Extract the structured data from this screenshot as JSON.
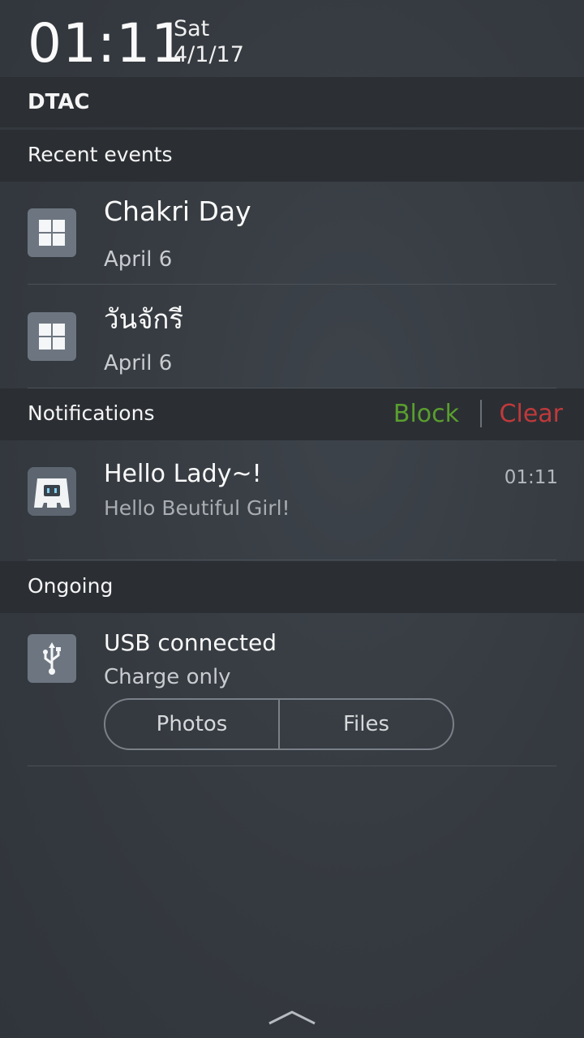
{
  "status": {
    "time": "01:11",
    "day": "Sat",
    "date": "4/1/17"
  },
  "carrier": "DTAC",
  "recent_events": {
    "header": "Recent events",
    "items": [
      {
        "title": "Chakri Day",
        "date": "April 6",
        "icon": "calendar-grid-icon"
      },
      {
        "title": "วันจักรี",
        "date": "April 6",
        "icon": "calendar-grid-icon"
      }
    ]
  },
  "notifications": {
    "header": "Notifications",
    "block_label": "Block",
    "clear_label": "Clear",
    "block_color": "#5a9e2e",
    "clear_color": "#c0393b",
    "items": [
      {
        "title": "Hello Lady~!",
        "body": "Hello Beutiful Girl!",
        "time": "01:11",
        "icon": "cordova-app-icon"
      }
    ]
  },
  "ongoing": {
    "header": "Ongoing",
    "items": [
      {
        "title": "USB connected",
        "subtitle": "Charge only",
        "icon": "usb-icon",
        "actions": [
          "Photos",
          "Files"
        ]
      }
    ]
  },
  "footer": {
    "icon": "chevron-up-icon"
  }
}
